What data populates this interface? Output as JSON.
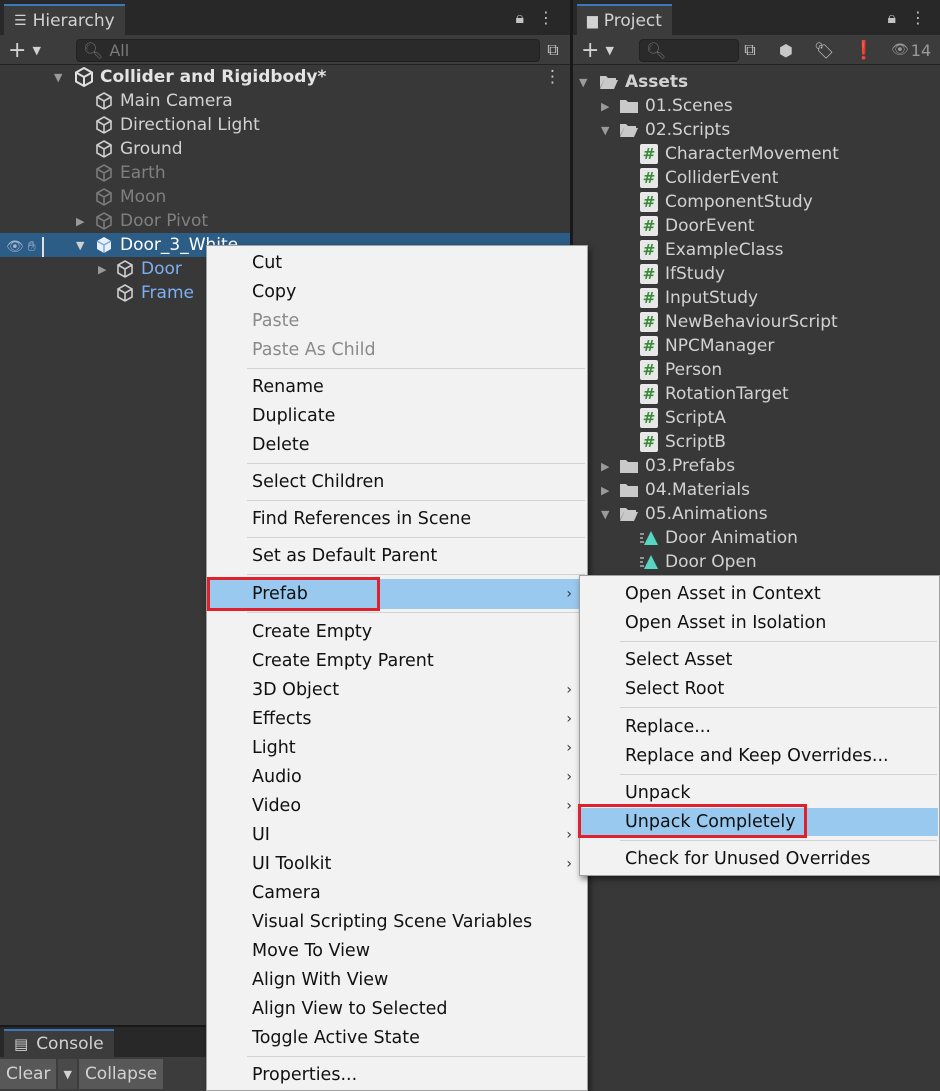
{
  "hierarchy": {
    "tab_label": "Hierarchy",
    "search_placeholder": "All",
    "scene_name": "Collider and Rigidbody*",
    "items": [
      {
        "label": "Main Camera"
      },
      {
        "label": "Directional Light"
      },
      {
        "label": "Ground"
      },
      {
        "label": "Earth"
      },
      {
        "label": "Moon"
      },
      {
        "label": "Door Pivot"
      },
      {
        "label": "Door_3_White"
      },
      {
        "label": "Door"
      },
      {
        "label": "Frame"
      }
    ]
  },
  "project": {
    "tab_label": "Project",
    "hidden_count": "14",
    "tree": {
      "assets": "Assets",
      "scenes": "01.Scenes",
      "scripts": "02.Scripts",
      "script_files": [
        "CharacterMovement",
        "ColliderEvent",
        "ComponentStudy",
        "DoorEvent",
        "ExampleClass",
        "IfStudy",
        "InputStudy",
        "NewBehaviourScript",
        "NPCManager",
        "Person",
        "RotationTarget",
        "ScriptA",
        "ScriptB"
      ],
      "prefabs": "03.Prefabs",
      "materials": "04.Materials",
      "animations": "05.Animations",
      "animation_files": [
        "Door Animation",
        "Door Open"
      ]
    }
  },
  "console": {
    "tab_label": "Console",
    "clear_label": "Clear",
    "collapse_label": "Collapse"
  },
  "context_menu": {
    "items": [
      {
        "label": "Cut"
      },
      {
        "label": "Copy"
      },
      {
        "label": "Paste"
      },
      {
        "label": "Paste As Child"
      },
      {
        "label": "Rename"
      },
      {
        "label": "Duplicate"
      },
      {
        "label": "Delete"
      },
      {
        "label": "Select Children"
      },
      {
        "label": "Find References in Scene"
      },
      {
        "label": "Set as Default Parent"
      },
      {
        "label": "Prefab"
      },
      {
        "label": "Create Empty"
      },
      {
        "label": "Create Empty Parent"
      },
      {
        "label": "3D Object"
      },
      {
        "label": "Effects"
      },
      {
        "label": "Light"
      },
      {
        "label": "Audio"
      },
      {
        "label": "Video"
      },
      {
        "label": "UI"
      },
      {
        "label": "UI Toolkit"
      },
      {
        "label": "Camera"
      },
      {
        "label": "Visual Scripting Scene Variables"
      },
      {
        "label": "Move To View"
      },
      {
        "label": "Align With View"
      },
      {
        "label": "Align View to Selected"
      },
      {
        "label": "Toggle Active State"
      },
      {
        "label": "Properties..."
      }
    ]
  },
  "prefab_submenu": {
    "items": [
      {
        "label": "Open Asset in Context"
      },
      {
        "label": "Open Asset in Isolation"
      },
      {
        "label": "Select Asset"
      },
      {
        "label": "Select Root"
      },
      {
        "label": "Replace..."
      },
      {
        "label": "Replace and Keep Overrides..."
      },
      {
        "label": "Unpack"
      },
      {
        "label": "Unpack Completely"
      },
      {
        "label": "Check for Unused Overrides"
      }
    ]
  },
  "colors": {
    "highlight": "#99c9ef",
    "annotation_red": "#e0202a",
    "selection_blue": "#2c5d87"
  }
}
